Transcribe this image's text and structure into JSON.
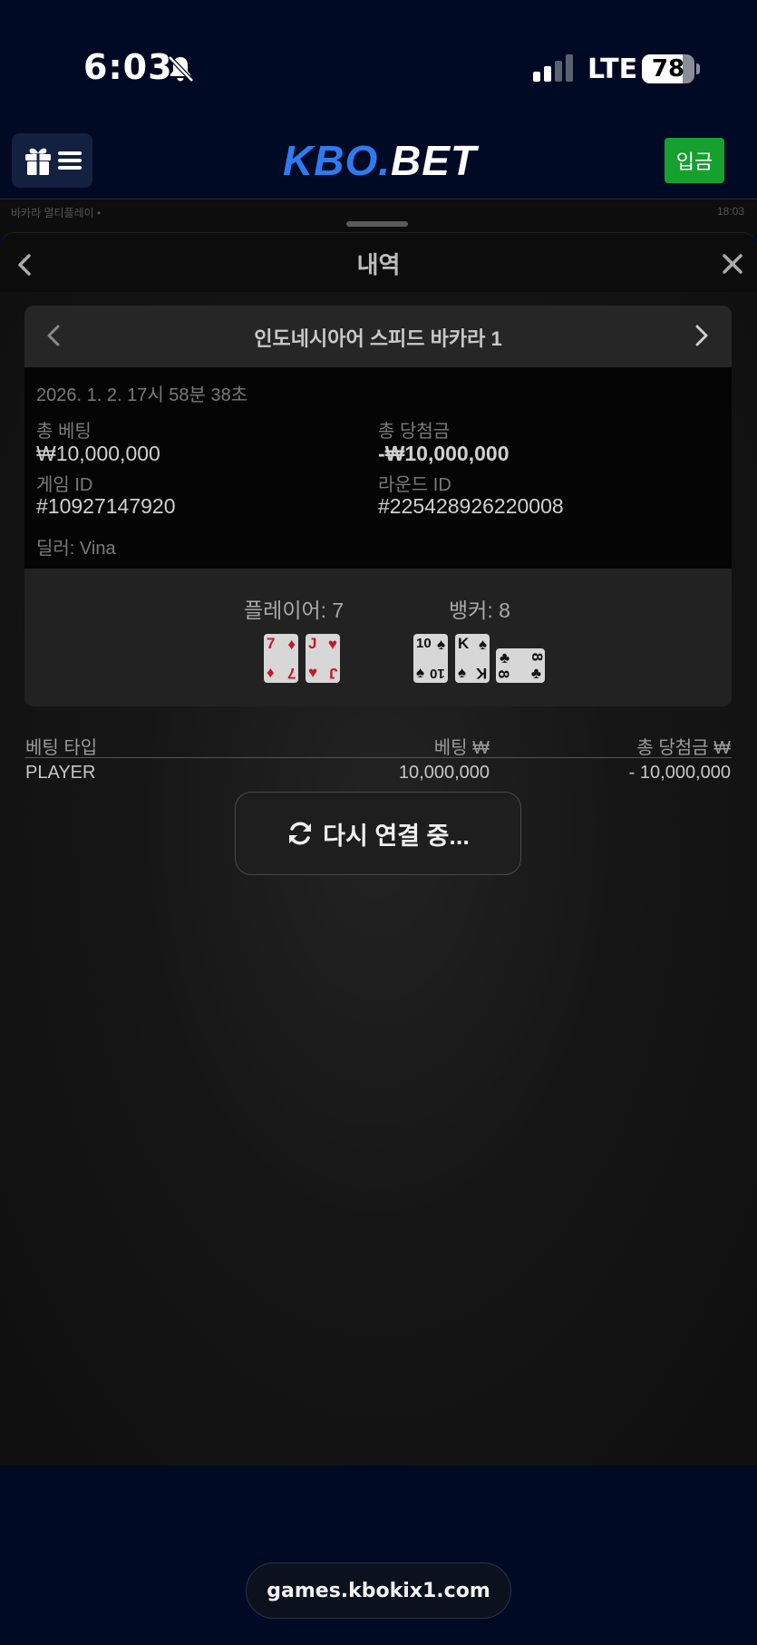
{
  "status_bar": {
    "time": "6:03",
    "network": "LTE",
    "battery": "78",
    "battery_level_percent": 78,
    "icons": [
      "bell-slash-icon",
      "signal-icon",
      "battery-icon"
    ]
  },
  "header": {
    "logo_kbo": "KBO",
    "logo_dot": ".",
    "logo_bet": "BET",
    "deposit_label": "입금",
    "menu_icons": [
      "gift-icon",
      "menu-icon"
    ],
    "colors": {
      "logo_blue": "#2e7bf0",
      "deposit_green": "#16a02e",
      "background": "#010a24"
    }
  },
  "game_strip": {
    "left_text": "바카라 멀티플레이 •",
    "right_text": "18:03"
  },
  "panel": {
    "title": "내역"
  },
  "game": {
    "title": "인도네시아어 스피드 바카라 1",
    "datetime": "2026. 1. 2. 17시 58분 38초",
    "total_bet_label": "총 베팅",
    "total_bet_value": "₩10,000,000",
    "total_win_label": "총 당첨금",
    "total_win_value": "-₩10,000,000",
    "game_id_label": "게임 ID",
    "game_id_value": "#10927147920",
    "round_id_label": "라운드 ID",
    "round_id_value": "#225428926220008",
    "dealer": "딜러: Vina",
    "player_label": "플레이어: 7",
    "banker_label": "뱅커: 8",
    "player_cards": [
      {
        "rank": "7",
        "suit": "♦",
        "color": "#c4182a"
      },
      {
        "rank": "J",
        "suit": "♥",
        "color": "#c4182a"
      }
    ],
    "banker_cards": [
      {
        "rank": "10",
        "suit": "♠",
        "color": "#111111"
      },
      {
        "rank": "K",
        "suit": "♠",
        "color": "#111111"
      },
      {
        "rank": "8",
        "suit": "♣",
        "color": "#111111"
      }
    ]
  },
  "bet_table": {
    "headers": [
      "베팅 타입",
      "베팅 ₩",
      "총 당첨금 ₩"
    ],
    "rows": [
      [
        "PLAYER",
        "10,000,000",
        "- 10,000,000"
      ]
    ]
  },
  "toast": {
    "text": "다시 연결 중..."
  },
  "browser": {
    "url": "games.kbokix1.com"
  }
}
